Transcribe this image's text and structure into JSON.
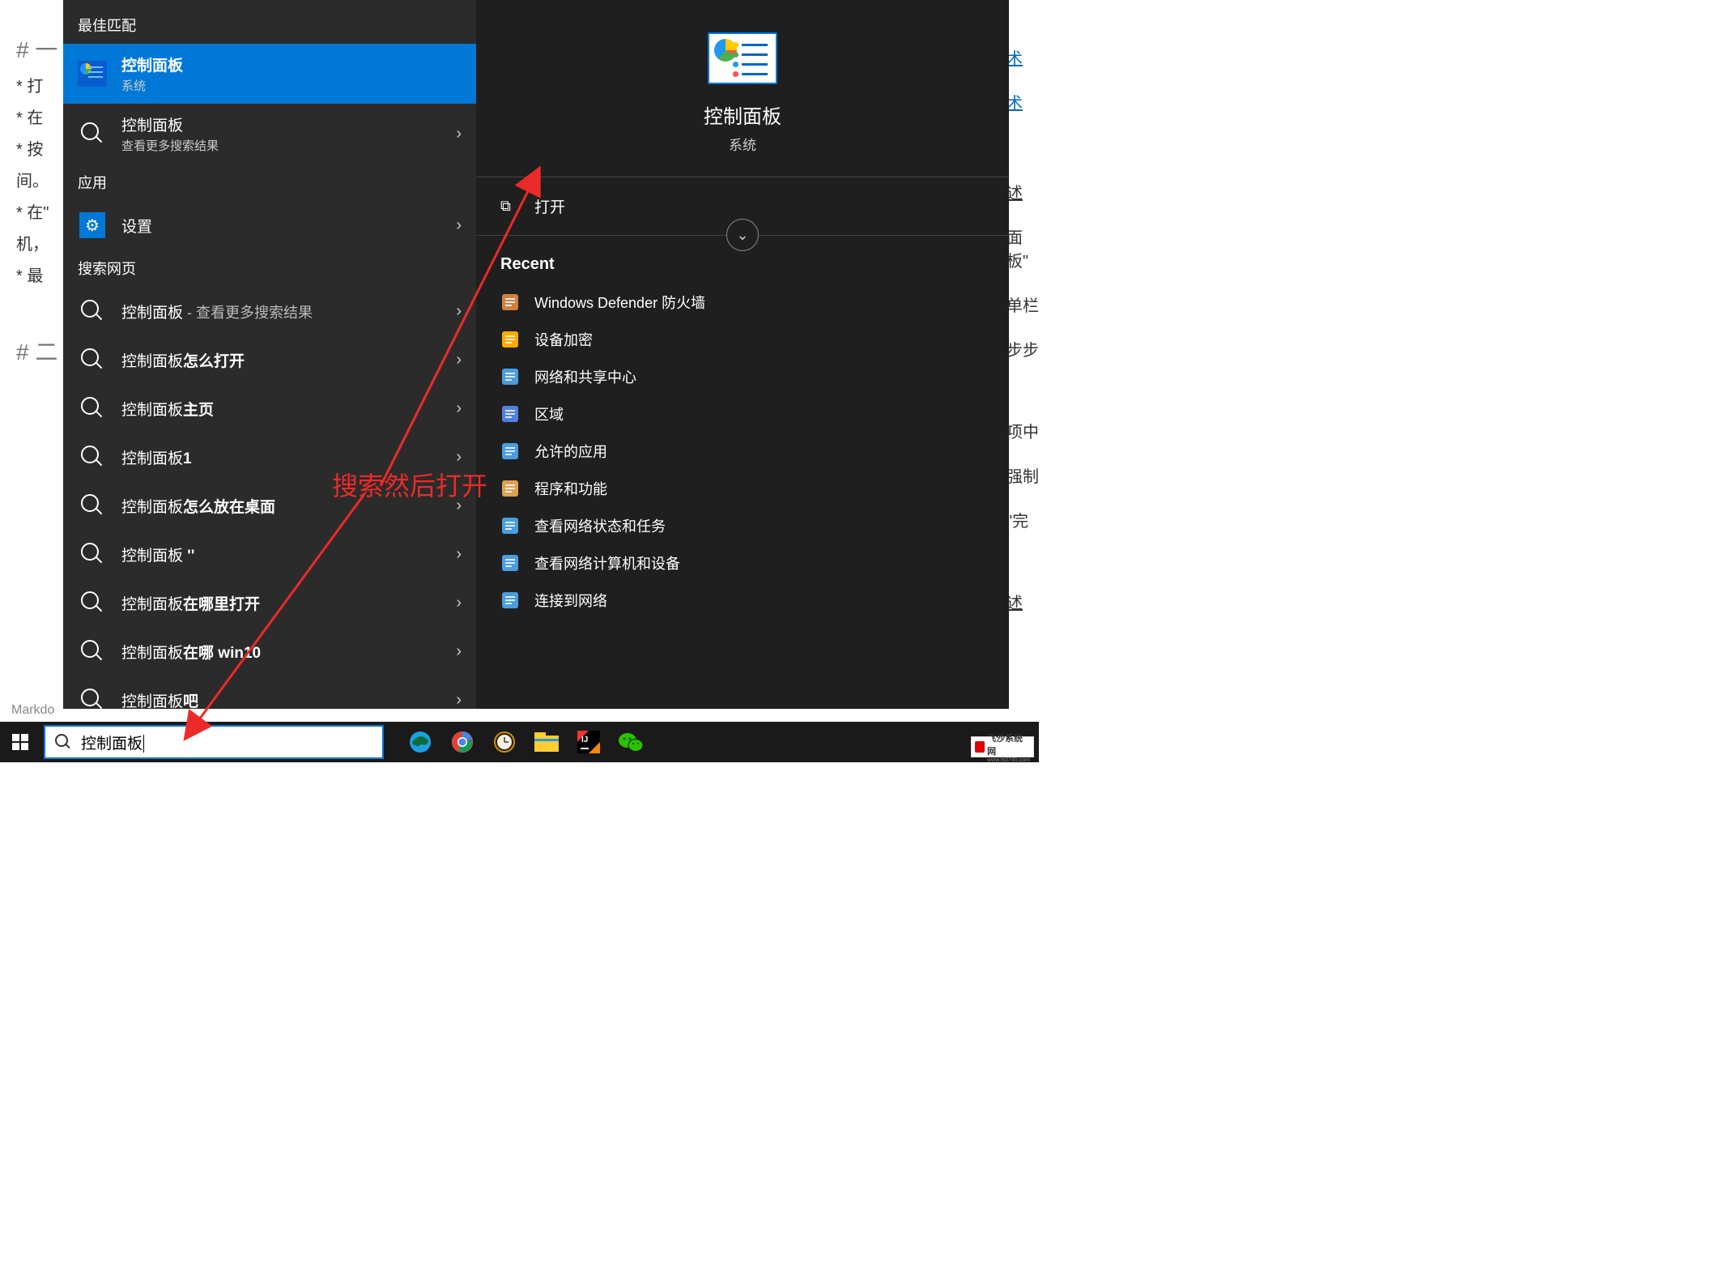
{
  "bg": {
    "h1": "# 一",
    "l1": "* 打",
    "l2": "* 在",
    "l3": "* 按",
    "l4": "间。",
    "l5": "* 在\"",
    "l6": "机，",
    "l7": "* 最",
    "h2": "# 二",
    "markdo": "Markdo",
    "r1": "术",
    "r2": "术",
    "r3": "述",
    "r4": "面板\"",
    "r5": "单栏",
    "r6": "步步",
    "r7": "项中",
    "r8": "强制",
    "r9": "\"完",
    "r10": "述"
  },
  "panel": {
    "best_match": "最佳匹配",
    "apps": "应用",
    "search_web": "搜索网页",
    "results": {
      "cp": {
        "title": "控制面板",
        "sub": "系统"
      },
      "more": {
        "title": "控制面板",
        "sub": "查看更多搜索结果"
      },
      "settings": "设置",
      "web1": "控制面板",
      "web1_extra": " - 查看更多搜索结果",
      "web2a": "控制面板",
      "web2b": "怎么打开",
      "web3a": "控制面板",
      "web3b": "主页",
      "web4a": "控制面板",
      "web4b": "1",
      "web5a": "控制面板",
      "web5b": "怎么放在桌面",
      "web6a": "控制面板",
      "web6b": " ''",
      "web7a": "控制面板",
      "web7b": "在哪里打开",
      "web8a": "控制面板",
      "web8b": "在哪 win10",
      "web9a": "控制面板",
      "web9b": "吧"
    }
  },
  "preview": {
    "title": "控制面板",
    "sub": "系统",
    "open": "打开",
    "recent_label": "Recent",
    "recent": [
      "Windows Defender 防火墙",
      "设备加密",
      "网络和共享中心",
      "区域",
      "允许的应用",
      "程序和功能",
      "查看网络状态和任务",
      "查看网络计算机和设备",
      "连接到网络"
    ]
  },
  "annotation": "搜索然后打开",
  "taskbar": {
    "search_value": "控制面板"
  },
  "watermark": {
    "brand": "飞沙系统网",
    "url": "www.fs0745.com"
  },
  "recent_icon_colors": [
    "#d08040",
    "#ffaa00",
    "#4a9de0",
    "#5080e0",
    "#4a9de0",
    "#e0a050",
    "#4a9de0",
    "#4a9de0",
    "#4a9de0"
  ]
}
